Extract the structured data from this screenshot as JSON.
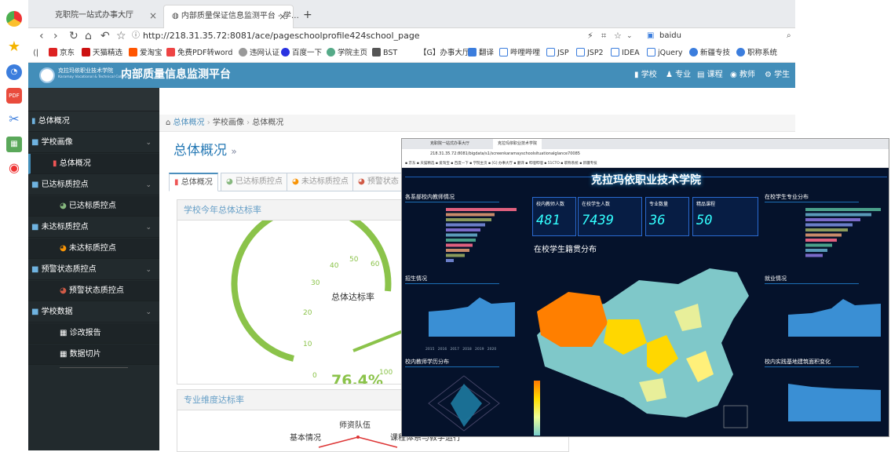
{
  "browser": {
    "tabs": [
      {
        "title": "克职院一站式办事大厅",
        "close": "×"
      },
      {
        "title": "内部质量保证信息监测平台 - 学…",
        "close": "×"
      }
    ],
    "new_tab": "+",
    "url": "http://218.31.35.72:8081/ace/pageschoolprofile424school_page",
    "search_text": "baidu",
    "bookmarks": [
      "京东",
      "天猫精选",
      "爱淘宝",
      "免费PDF转word",
      "违网认证",
      "百度一下",
      "学院主页",
      "BST",
      "【G】办事大厅",
      "翻译",
      "哔哩哔哩",
      "JSP",
      "JSP2",
      "IDEA",
      "jQuery",
      "新疆专技",
      "职称系统"
    ]
  },
  "app": {
    "school_name_cn": "克拉玛依职业技术学院",
    "school_name_en": "Karamay Vocational & Technical College",
    "title": "内部质量信息监测平台",
    "nav": [
      "学校",
      "专业",
      "课程",
      "教师",
      "学生"
    ]
  },
  "sidebar": {
    "items": [
      {
        "label": "总体概况"
      },
      {
        "label": "学校画像"
      },
      {
        "label": "总体概况"
      },
      {
        "label": "已达标质控点"
      },
      {
        "label": "已达标质控点"
      },
      {
        "label": "未达标质控点"
      },
      {
        "label": "未达标质控点"
      },
      {
        "label": "预警状态质控点"
      },
      {
        "label": "预警状态质控点"
      },
      {
        "label": "学校数据"
      },
      {
        "label": "诊改报告"
      },
      {
        "label": "数据切片"
      }
    ]
  },
  "breadcrumb": [
    "总体概况",
    "学校画像",
    "总体概况"
  ],
  "page": {
    "title": "总体概况",
    "title_suffix": "»",
    "tabs": [
      "总体概况",
      "已达标质控点",
      "未达标质控点",
      "预警状态"
    ],
    "panel1_title": "学校今年总体达标率",
    "gauge": {
      "label": "总体达标率",
      "value": "76.4%",
      "value_percent": 76.4,
      "ticks": [
        "0",
        "10",
        "20",
        "30",
        "40",
        "50",
        "60",
        "100"
      ]
    },
    "panel2_title": "专业维度达标率",
    "radar_labels": [
      "师资队伍",
      "基本情况",
      "课程体系与教学运行"
    ]
  },
  "overlay": {
    "tabs": [
      "克职院一站式办事大厅",
      "克拉玛依职业技术学院"
    ],
    "url": "218.31.35.72:8081/bigdata/s1/screenkaramayschoolsituationalglance70085",
    "title": "克拉玛依职业技术学院",
    "section_left1": "各系部校内教师情况",
    "section_left2": "招生情况",
    "section_left3": "校内教师学历分布",
    "section_right1": "在校学生专业分布",
    "section_right2": "就业情况",
    "section_right3": "校内实践基地建筑面积变化",
    "map_title": "在校学生籍贯分布",
    "kpis": [
      {
        "label": "校内教师人数",
        "value": "481"
      },
      {
        "label": "在校学生人数",
        "value": "7439"
      },
      {
        "label": "专业数量",
        "value": "36"
      },
      {
        "label": "精品课程",
        "value": "50"
      }
    ],
    "years": [
      "2015",
      "2016",
      "2017",
      "2018",
      "2019",
      "2020"
    ]
  },
  "colors": {
    "header": "#438eb9",
    "sidebar": "#222a2d",
    "gauge_green": "#8bc34a",
    "accent": "#2679b5"
  }
}
